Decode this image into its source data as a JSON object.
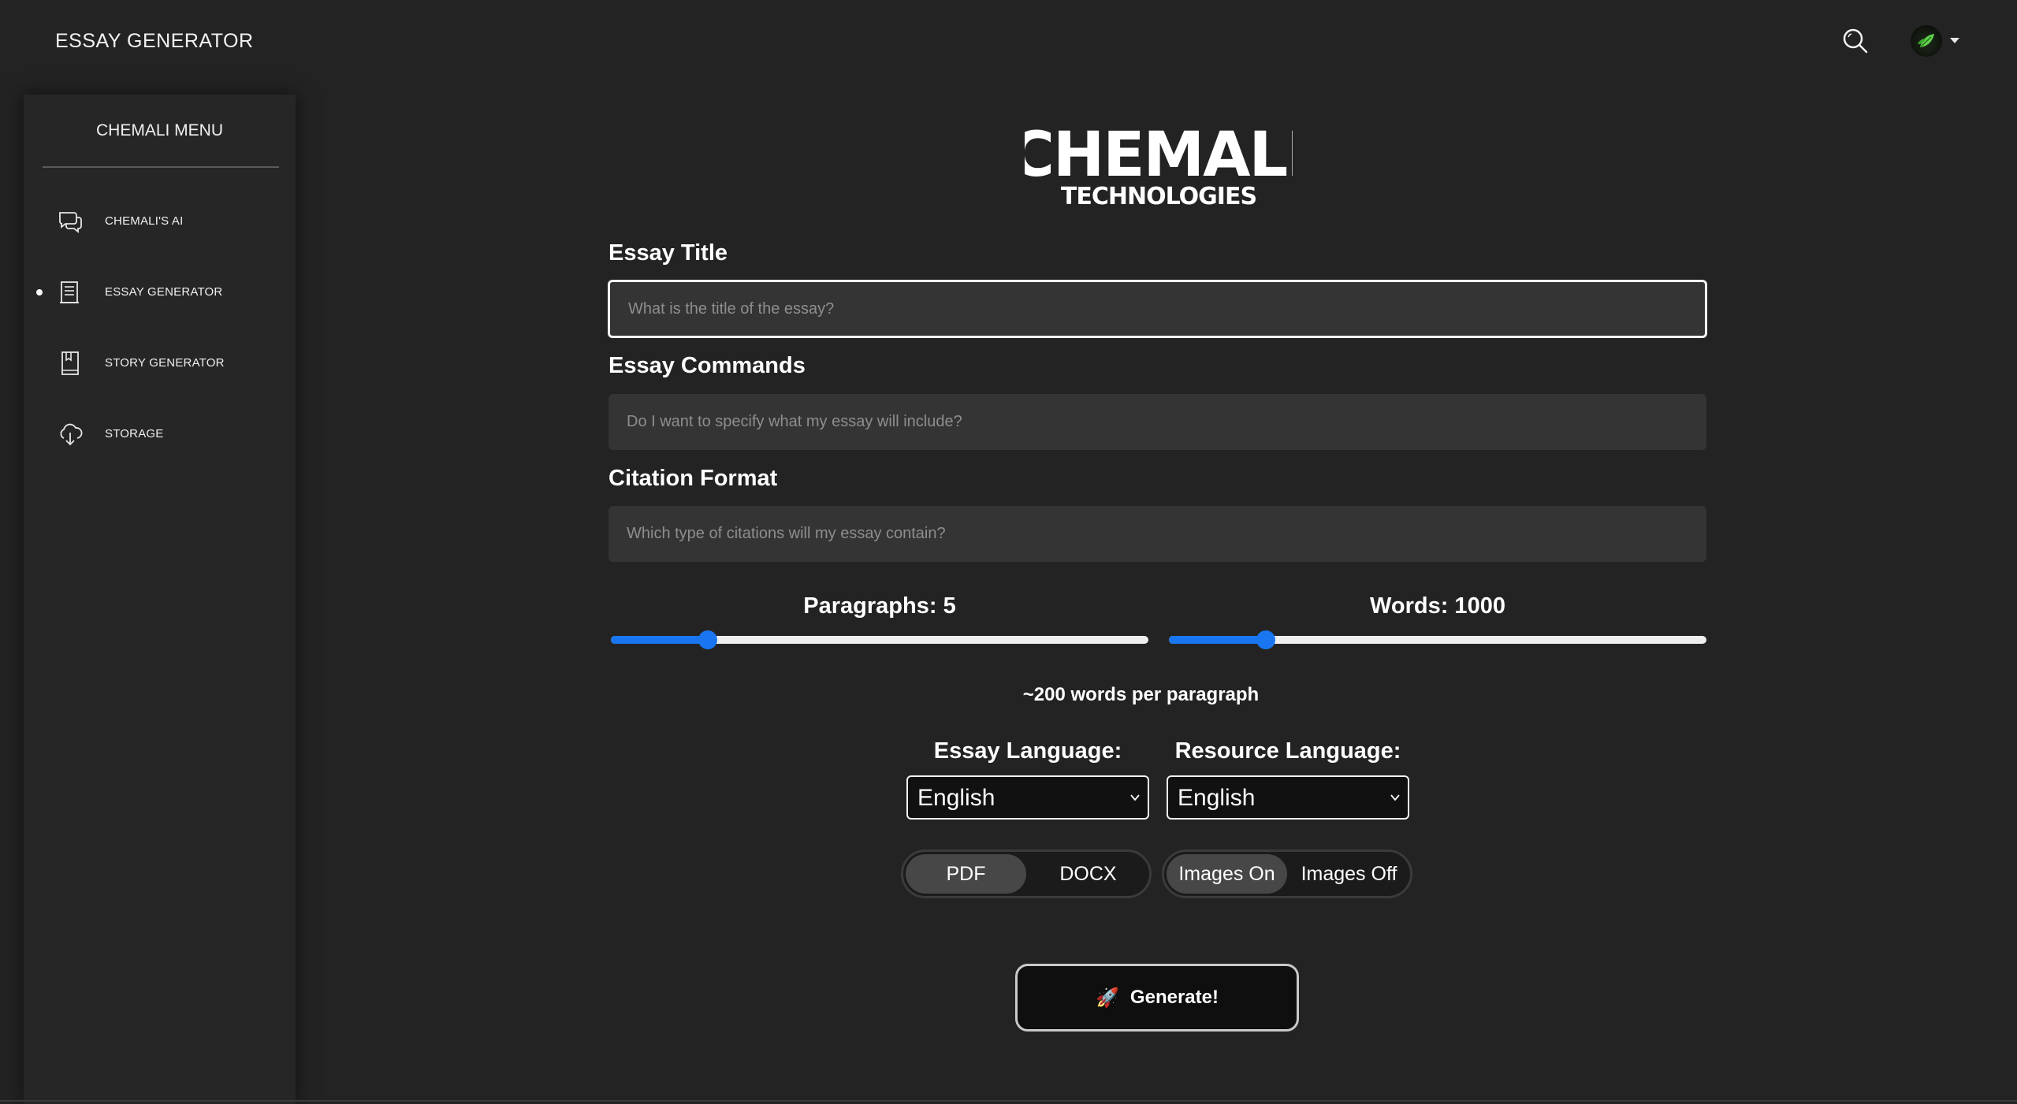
{
  "header": {
    "app_title": "ESSAY GENERATOR"
  },
  "sidebar": {
    "title": "CHEMALI MENU",
    "items": [
      {
        "label": "CHEMALI'S AI",
        "icon": "chat-bubbles-icon",
        "active": false
      },
      {
        "label": "ESSAY GENERATOR",
        "icon": "document-icon",
        "active": true
      },
      {
        "label": "STORY GENERATOR",
        "icon": "book-icon",
        "active": false
      },
      {
        "label": "STORAGE",
        "icon": "cloud-download-icon",
        "active": false
      }
    ]
  },
  "logo": {
    "line1": "CHEMALI",
    "line2": "TECHNOLOGIES"
  },
  "form": {
    "title_label": "Essay Title",
    "title_placeholder": "What is the title of the essay?",
    "commands_label": "Essay Commands",
    "commands_placeholder": "Do I want to specify what my essay will include?",
    "citation_label": "Citation Format",
    "citation_placeholder": "Which type of citations will my essay contain?"
  },
  "sliders": {
    "paragraphs_label": "Paragraphs: 5",
    "paragraphs_fraction": 0.18,
    "words_label": "Words: 1000",
    "words_fraction": 0.18,
    "hint": "~200 words per paragraph"
  },
  "languages": {
    "essay_label": "Essay Language:",
    "essay_value": "English",
    "resource_label": "Resource Language:",
    "resource_value": "English"
  },
  "toggles": {
    "format_options": [
      "PDF",
      "DOCX"
    ],
    "format_active": "PDF",
    "image_options": [
      "Images On",
      "Images Off"
    ],
    "image_active": "Images On"
  },
  "generate": {
    "emoji": "🚀",
    "label": "Generate!"
  },
  "colors": {
    "background": "#232323",
    "accent": "#1976f0",
    "input_bg": "#343434"
  }
}
